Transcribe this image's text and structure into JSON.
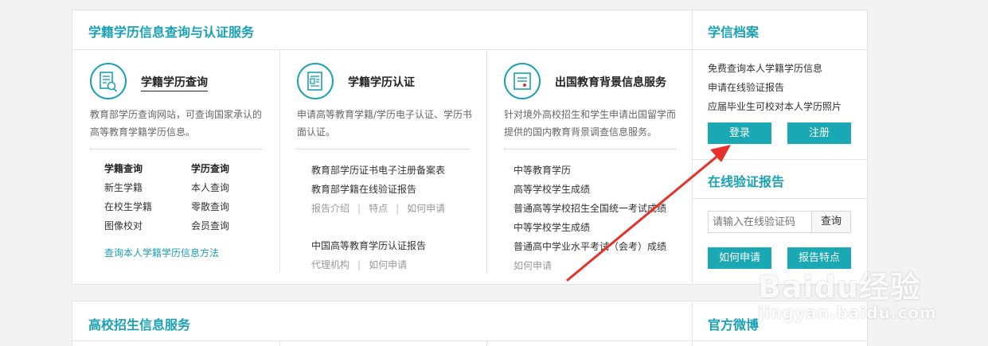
{
  "main": {
    "title": "学籍学历信息查询与认证服务",
    "services": [
      {
        "title": "学籍学历查询",
        "desc": "教育部学历查询网站，可查询国家承认的高等教育学籍学历信息。",
        "grid": [
          [
            "学籍查询",
            "学历查询"
          ],
          [
            "新生学籍",
            "本人查询"
          ],
          [
            "在校生学籍",
            "零散查询"
          ],
          [
            "图像校对",
            "会员查询"
          ]
        ],
        "link": "查询本人学籍学历信息方法"
      },
      {
        "title": "学籍学历认证",
        "desc": "申请高等教育学籍/学历电子认证、学历书面认证。",
        "lines": [
          "教育部学历证书电子注册备案表",
          "教育部学籍在线验证报告"
        ],
        "meta1": [
          "报告介绍",
          "特点",
          "如何申请"
        ],
        "line3": "中国高等教育学历认证报告",
        "meta2": [
          "代理机构",
          "如何申请"
        ]
      },
      {
        "title": "出国教育背景信息服务",
        "desc": "针对境外高校招生和学生申请出国留学而提供的国内教育背景调查信息服务。",
        "lines": [
          "中等教育学历",
          "高等学校学生成绩",
          "普通高等学校招生全国统一考试成绩",
          "中等学校学生成绩",
          "普通高中学业水平考试（会考）成绩"
        ],
        "apply": "如何申请"
      }
    ]
  },
  "side": {
    "title": "学信档案",
    "lines": [
      "免费查询本人学籍学历信息",
      "申请在线验证报告",
      "应届毕业生可校对本人学历照片"
    ],
    "login": "登录",
    "register": "注册",
    "verify_title": "在线验证报告",
    "verify_placeholder": "请输入在线验证码",
    "query": "查询",
    "how_apply": "如何申请",
    "report_features": "报告特点"
  },
  "bottom": {
    "title": "高校招生信息服务",
    "side_title": "官方微博"
  },
  "watermark": {
    "main": "Baidu经验",
    "sub": "jingyan.baidu.com"
  },
  "colors": {
    "accent": "#1aa1b3",
    "button": "#1aa8b5",
    "arrow": "#e8302a"
  }
}
